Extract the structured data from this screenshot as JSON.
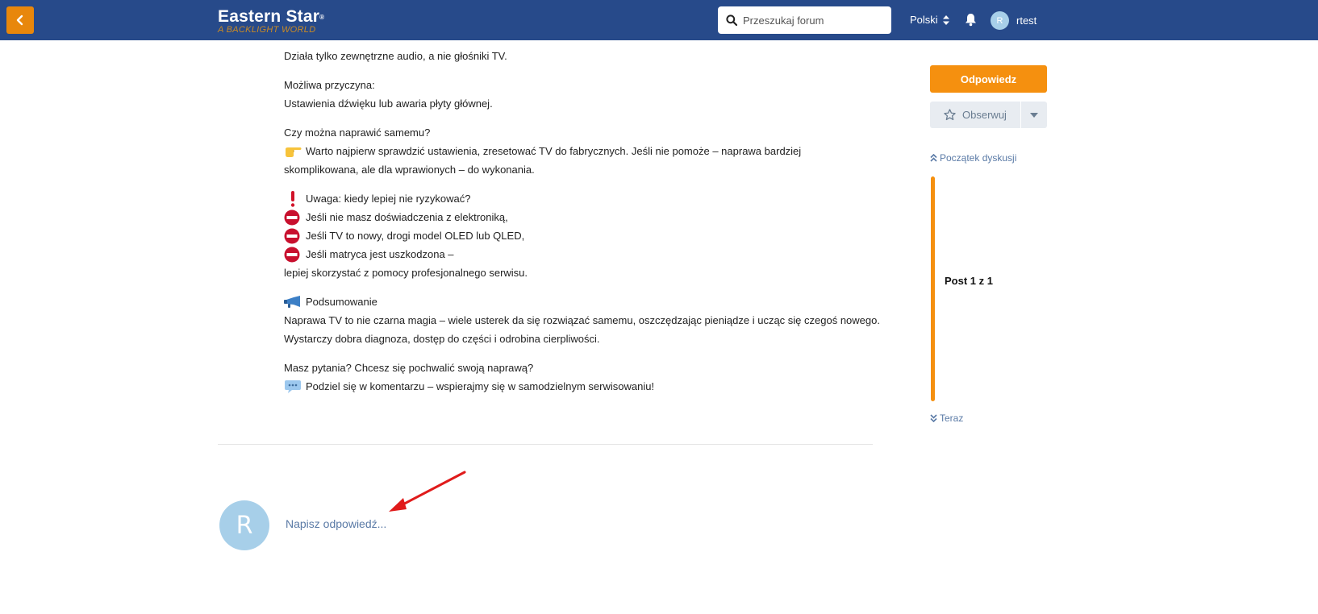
{
  "header": {
    "logo_title": "Eastern Star",
    "logo_registered": "®",
    "logo_tagline": "A BACKLIGHT WORLD",
    "search_placeholder": "Przeszukaj forum",
    "language": "Polski",
    "user_initial": "R",
    "username": "rtest",
    "colors": {
      "header_bg": "#274a8a",
      "accent": "#f5900f"
    }
  },
  "post": {
    "p1": "Działa tylko zewnętrzne audio, a nie głośniki TV.",
    "p2_line1": "Możliwa przyczyna:",
    "p2_line2": "Ustawienia dźwięku lub awaria płyty głównej.",
    "p3_line1": "Czy można naprawić samemu?",
    "p3_line2": "Warto najpierw sprawdzić ustawienia, zresetować TV do fabrycznych. Jeśli nie pomoże – naprawa bardziej",
    "p3_line3": "skomplikowana, ale dla wprawionych – do wykonania.",
    "p4_line1": "Uwaga: kiedy lepiej nie ryzykować?",
    "p4_line2": "Jeśli nie masz doświadczenia z elektroniką,",
    "p4_line3": "Jeśli TV to nowy, drogi model OLED lub QLED,",
    "p4_line4": "Jeśli matryca jest uszkodzona –",
    "p4_line5": "lepiej skorzystać z pomocy profesjonalnego serwisu.",
    "p5_line1": "Podsumowanie",
    "p5_line2": "Naprawa TV to nie czarna magia – wiele usterek da się rozwiązać samemu, oszczędzając pieniądze i ucząc się czegoś nowego.",
    "p5_line3": "Wystarczy dobra diagnoza, dostęp do części i odrobina cierpliwości.",
    "p6_line1": "Masz pytania? Chcesz się pochwalić swoją naprawą?",
    "p6_line2": "Podziel się w komentarzu – wspierajmy się w samodzielnym serwisowaniu!",
    "icons": [
      "pointing-hand-icon",
      "exclamation-icon",
      "no-entry-icon",
      "megaphone-icon",
      "speech-bubble-icon"
    ]
  },
  "reply": {
    "avatar_initial": "R",
    "placeholder": "Napisz odpowiedź..."
  },
  "sidebar": {
    "reply_button": "Odpowiedz",
    "follow_button": "Obserwuj",
    "scrubber_top": "Początek dyskusji",
    "scrubber_label": "Post 1 z 1",
    "scrubber_bottom": "Teraz"
  }
}
